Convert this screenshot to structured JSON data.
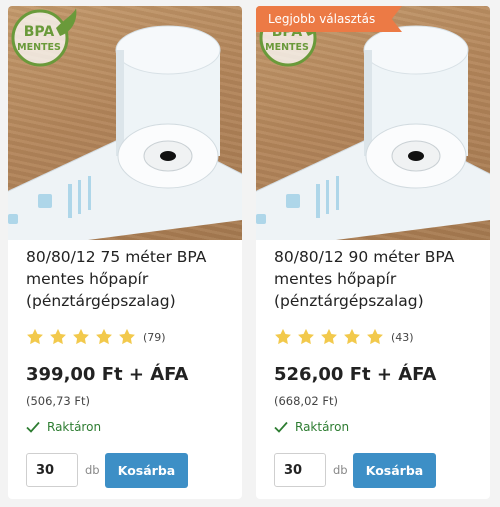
{
  "products": [
    {
      "badge": {
        "line1": "BPA",
        "line2": "MENTES"
      },
      "ribbon": "",
      "title": "80/80/12 75 méter BPA mentes hőpapír (pénztárgépszalag)",
      "rating": 5,
      "review_count": "(79)",
      "price": "399,00 Ft + ÁFA",
      "gross_price": "(506,73 Ft)",
      "stock": "Raktáron",
      "quantity": "30",
      "unit": "db",
      "cart_label": "Kosárba"
    },
    {
      "badge": {
        "line1": "BPA",
        "line2": "MENTES"
      },
      "ribbon": "Legjobb választás",
      "title": "80/80/12 90 méter BPA mentes hőpapír (pénztárgépszalag)",
      "rating": 5,
      "review_count": "(43)",
      "price": "526,00 Ft + ÁFA",
      "gross_price": "(668,02 Ft)",
      "stock": "Raktáron",
      "quantity": "30",
      "unit": "db",
      "cart_label": "Kosárba"
    }
  ],
  "colors": {
    "accent": "#3d8fc6",
    "ribbon": "#ec7a45",
    "badge_green": "#6a9a3a",
    "star": "#f2c94c",
    "in_stock": "#2e7d32"
  },
  "icons": {
    "star": "star-icon",
    "stock": "checkmark-icon",
    "badge_leaf": "leaf-icon"
  }
}
